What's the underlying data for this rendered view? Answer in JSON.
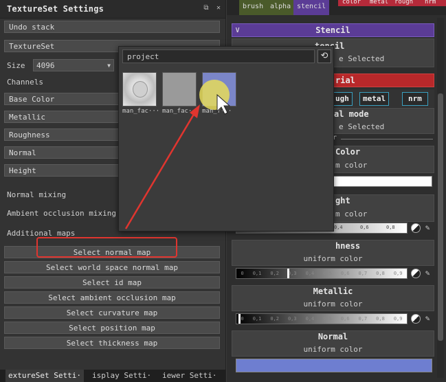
{
  "left_panel": {
    "title": "TextureSet Settings",
    "undo_stack": "Undo stack",
    "textureset": "TextureSet",
    "size_label": "Size",
    "size_value": "4096",
    "channels_label": "Channels",
    "channels": [
      "Base Color",
      "Metallic",
      "Roughness",
      "Normal",
      "Height"
    ],
    "normal_mixing": "Normal mixing",
    "ao_mixing": "Ambient occlusion mixing",
    "additional_maps": "Additional maps",
    "map_buttons": [
      "Select normal map",
      "Select world space normal map",
      "Select id map",
      "Select ambient occlusion map",
      "Select curvature map",
      "Select position map",
      "Select thickness map"
    ],
    "tabs": [
      "extureSet Setti·",
      "isplay Setti·",
      "iewer Setti·"
    ]
  },
  "right_panel": {
    "top_tabs": [
      "brush",
      "alpha",
      "stencil"
    ],
    "channel_tabs": [
      "color",
      "metal",
      "rough",
      "nrm"
    ],
    "stencil_title": "Stencil",
    "stencil_inner_title": "tencil",
    "stencil_inner_sub": "e Selected",
    "material_title": "rial",
    "material_buttons": [
      "ugh",
      "metal",
      "nrm"
    ],
    "material_mode": "al mode",
    "material_mode_sub": "e Selected",
    "color_header": "r",
    "base_color_title": "Color",
    "base_color_sub": "m color",
    "height_title": "ght",
    "height_sub": "m color",
    "height_ticks": [
      "0,4",
      "0,6",
      "0,8"
    ],
    "roughness_title": "hness",
    "roughness_sub": "uniform color",
    "roughness_ticks": [
      "0",
      "0,1",
      "0,2",
      "0,3",
      "0,4",
      "0,5",
      "0,6",
      "0,7",
      "0,8",
      "0,9"
    ],
    "metallic_title": "Metallic",
    "metallic_sub": "uniform color",
    "metallic_ticks": [
      "0",
      "0,1",
      "0,2",
      "0,3",
      "0,4",
      "0,5",
      "0,6",
      "0,7",
      "0,8",
      "0,9"
    ],
    "normal_title": "Normal",
    "normal_sub": "uniform color",
    "colors": {
      "stencil_bar": "#5b3c96",
      "material_bar": "#b8282a",
      "normal_swatch": "#6e7ed0",
      "channel_tab": "#b52a3a"
    }
  },
  "popup": {
    "search_value": "project",
    "refresh_icon": "refresh-icon",
    "thumbnails": [
      "man_fac···",
      "man_fac···",
      "man_f···"
    ]
  },
  "annotation": {
    "arrow_color": "#e0352f"
  }
}
